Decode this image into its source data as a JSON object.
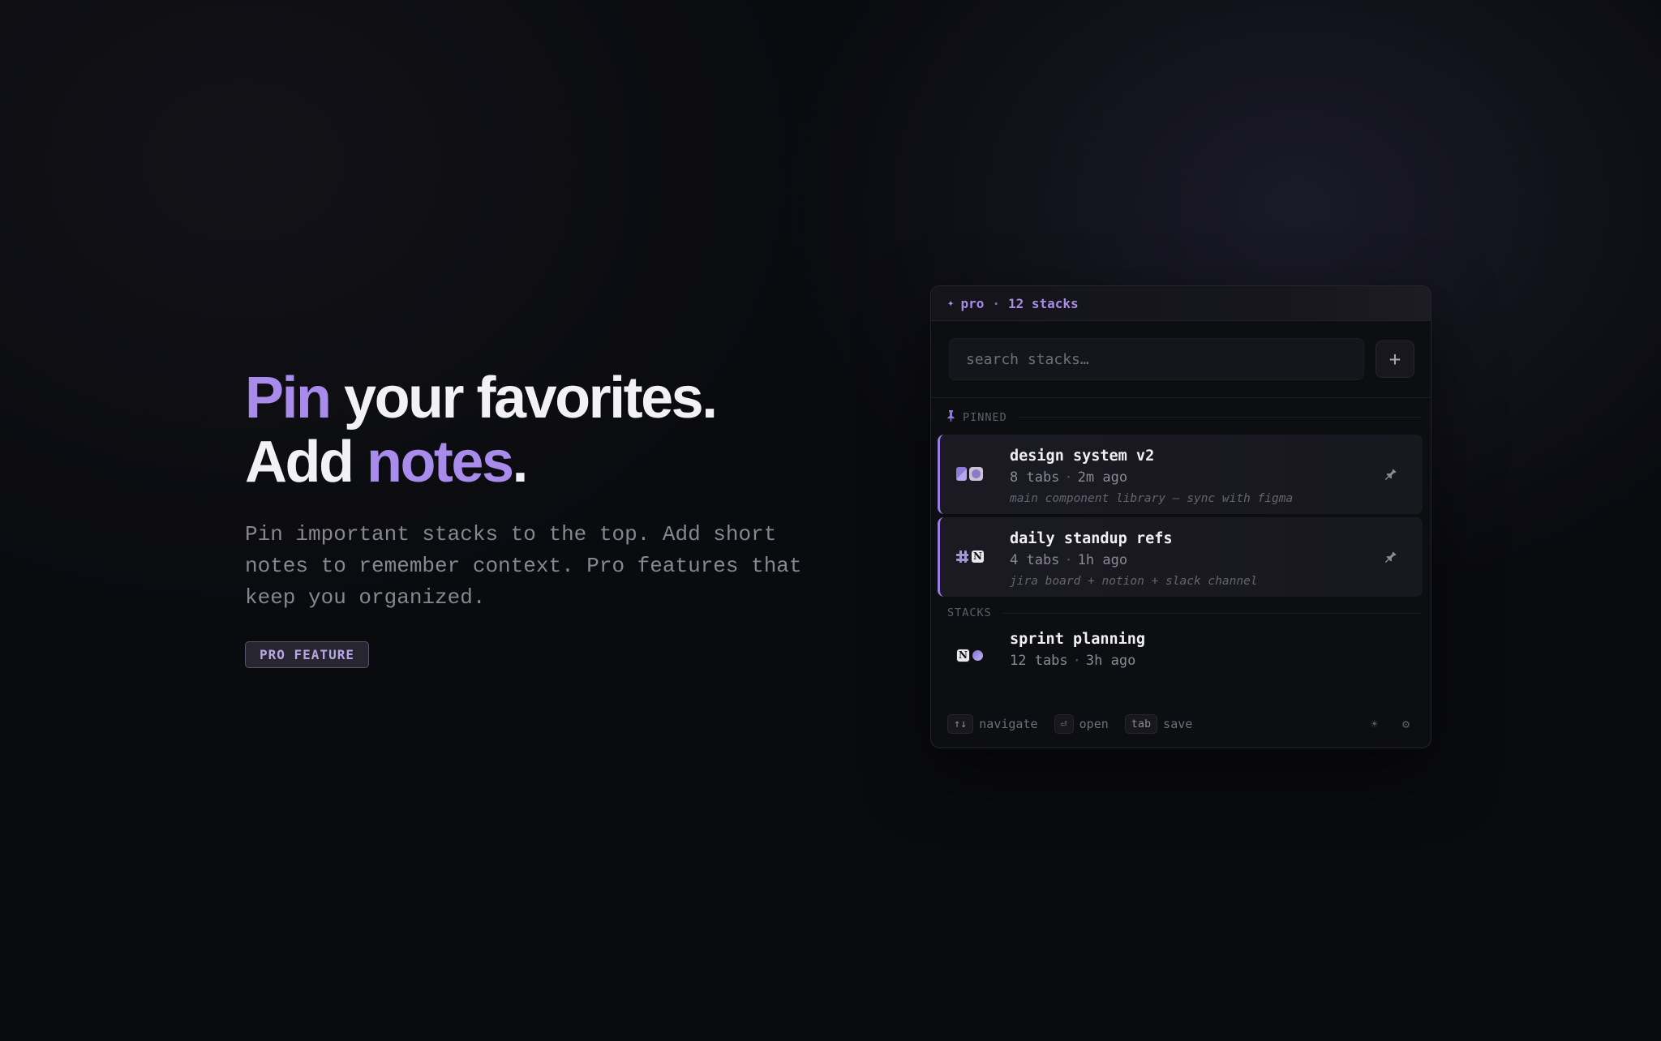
{
  "hero": {
    "title_line1_accent": "Pin",
    "title_line1_rest": " your favorites.",
    "title_line2_start": "Add ",
    "title_line2_accent": "notes",
    "title_line2_end": ".",
    "description": "Pin important stacks to the top. Add short notes to remember context. Pro features that keep you organized.",
    "badge": "PRO FEATURE"
  },
  "panel": {
    "header": {
      "sparkle": "✦",
      "plan": "pro",
      "separator": "·",
      "count": "12 stacks"
    },
    "search": {
      "placeholder": "search stacks…",
      "value": ""
    },
    "add_button": "+",
    "pinned_label": "PINNED",
    "stacks_label": "STACKS",
    "pinned_items": [
      {
        "title": "design system v2",
        "tabs": "8 tabs",
        "time": "2m ago",
        "note": "main component library — sync with figma",
        "favicons": [
          "figma-icon",
          "dribbble-icon"
        ]
      },
      {
        "title": "daily standup refs",
        "tabs": "4 tabs",
        "time": "1h ago",
        "note": "jira board + notion + slack channel",
        "favicons": [
          "slack-icon",
          "notion-icon"
        ]
      }
    ],
    "stack_items": [
      {
        "title": "sprint planning",
        "tabs": "12 tabs",
        "time": "3h ago",
        "favicons": [
          "notion-icon",
          "linear-icon"
        ]
      }
    ],
    "footer": {
      "navigate_key": "↑↓",
      "navigate_label": "navigate",
      "open_key": "⏎",
      "open_label": "open",
      "save_key": "tab",
      "save_label": "save"
    }
  },
  "colors": {
    "accent": "#a98bec",
    "background": "#0a0b0f",
    "panel": "#0d0e12"
  }
}
